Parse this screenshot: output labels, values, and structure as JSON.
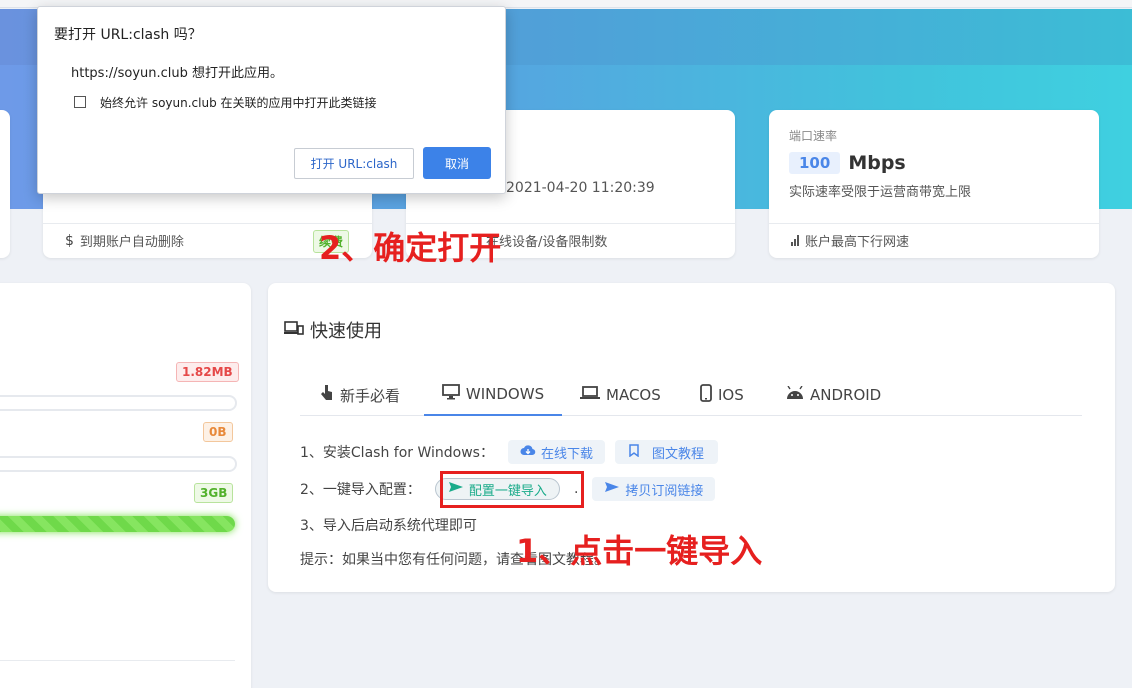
{
  "dialog": {
    "title": "要打开 URL:clash 吗？",
    "message": "https://soyun.club 想打开此应用。",
    "checkbox_label": "始终允许 soyun.club 在关联的应用中打开此类链接",
    "open_button": "打开 URL:clash",
    "cancel_button": "取消"
  },
  "cards": {
    "expire_card": {
      "foot_text": "到期账户自动删除",
      "renew_tag": "续费"
    },
    "device_card": {
      "datetime": "2021-04-20 11:20:39",
      "foot_text": "在线设备/设备限制数"
    },
    "speed_card": {
      "label": "端口速率",
      "value": "100",
      "unit": "Mbps",
      "desc": "实际速率受限于运营商带宽上限",
      "foot_text": "账户最高下行网速"
    }
  },
  "traffic": {
    "used_tag": "1.82MB",
    "today_tag": "0B",
    "remain_tag": "3GB",
    "remain_fraction": 1.0
  },
  "quick": {
    "title": "快速使用",
    "tabs": [
      {
        "label": "新手必看",
        "icon": "hand-pointer-icon"
      },
      {
        "label": "WINDOWS",
        "icon": "monitor-icon"
      },
      {
        "label": "MACOS",
        "icon": "laptop-icon"
      },
      {
        "label": "IOS",
        "icon": "phone-icon"
      },
      {
        "label": "ANDROID",
        "icon": "android-icon"
      }
    ],
    "step1": "1、安装Clash for Windows：",
    "step1_download": "在线下载",
    "step1_tutorial": "图文教程",
    "step2": "2、一键导入配置：",
    "step2_import": "配置一键导入",
    "step2_sep": ".",
    "step2_copy": "拷贝订阅链接",
    "step3": "3、导入后启动系统代理即可",
    "tip": "提示：如果当中您有任何问题，请查看图文教程。"
  },
  "annotations": {
    "a1": "1、点击一键导入",
    "a2": "2、确定打开"
  },
  "colors": {
    "accent": "#4a86e8",
    "annotation_red": "#e6201f",
    "import_green": "#1aab8a"
  }
}
